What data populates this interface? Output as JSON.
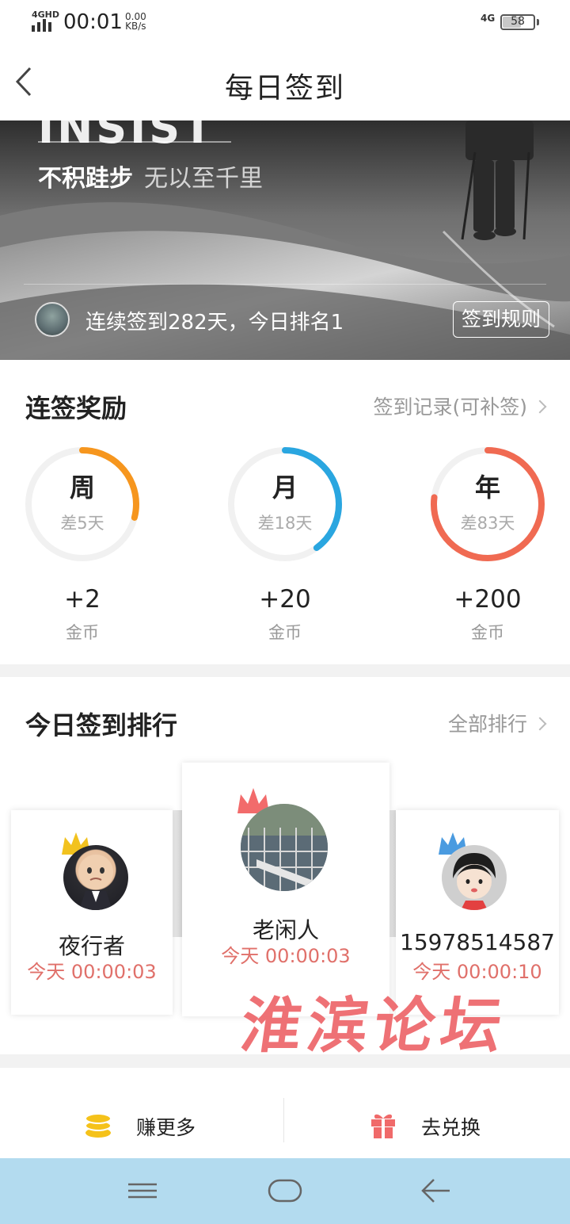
{
  "status_bar": {
    "network": "4GHD",
    "time": "00:01",
    "speed_value": "0.00",
    "speed_unit": "KB/s",
    "network_right": "4G",
    "battery": "58",
    "battery_fraction": 0.58
  },
  "header": {
    "title": "每日签到",
    "back_icon": "chevron-left-icon"
  },
  "banner": {
    "headline": "INSIST",
    "motto_bold": "不积跬步",
    "motto_light": "无以至千里",
    "streak_text": "连续签到282天，今日排名1",
    "rules_button": "签到规则"
  },
  "rewards": {
    "title": "连签奖励",
    "record_link": "签到记录(可补签)",
    "items": [
      {
        "label": "周",
        "remaining": "差5天",
        "amount": "+2",
        "unit": "金币",
        "color": "#f6961e",
        "progress": 0.29
      },
      {
        "label": "月",
        "remaining": "差18天",
        "amount": "+20",
        "unit": "金币",
        "color": "#2aa6e0",
        "progress": 0.4
      },
      {
        "label": "年",
        "remaining": "差83天",
        "amount": "+200",
        "unit": "金币",
        "color": "#f06a52",
        "progress": 0.77
      }
    ]
  },
  "ranking": {
    "title": "今日签到排行",
    "all_link": "全部排行",
    "entries": [
      {
        "rank": 2,
        "name": "夜行者",
        "time": "今天 00:00:03",
        "crown_color": "#f2c21e"
      },
      {
        "rank": 1,
        "name": "老闲人",
        "time": "今天 00:00:03",
        "crown_color": "#f26b6b"
      },
      {
        "rank": 3,
        "name": "15978514587",
        "time": "今天 00:00:10",
        "crown_color": "#4a9be0"
      }
    ],
    "watermark": "淮滨论坛"
  },
  "actions": {
    "earn_more": "赚更多",
    "redeem": "去兑换",
    "earn_icon": "coin-stack-icon",
    "redeem_icon": "gift-icon"
  },
  "nav": {
    "menu_icon": "menu-icon",
    "home_icon": "home-icon",
    "back_icon": "back-arrow-icon"
  }
}
